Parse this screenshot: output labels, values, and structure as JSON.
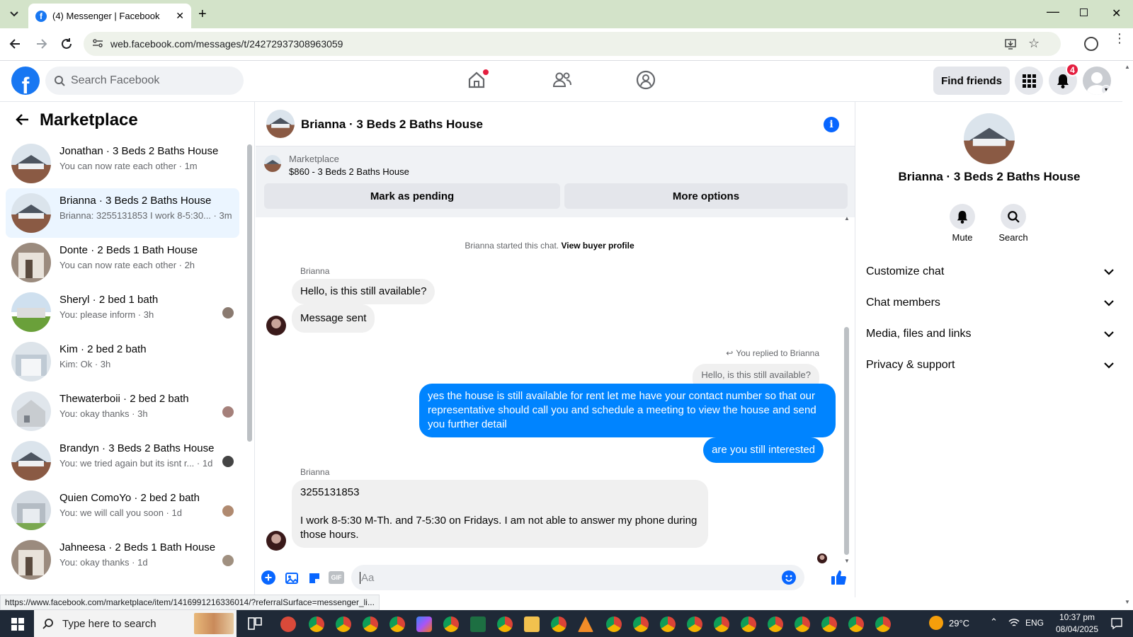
{
  "browser": {
    "tab_title": "(4) Messenger | Facebook",
    "url": "web.facebook.com/messages/t/24272937308963059"
  },
  "header": {
    "search_placeholder": "Search Facebook",
    "find_friends": "Find friends",
    "notification_count": "4"
  },
  "sidebar": {
    "title": "Marketplace",
    "conversations": [
      {
        "name": "Jonathan · 3 Beds 2 Baths House",
        "preview": "You can now rate each other · 1m"
      },
      {
        "name": "Brianna · 3 Beds 2 Baths House",
        "preview": "Brianna: 3255131853 I work 8-5:30... · 3m"
      },
      {
        "name": "Donte · 2 Beds 1 Bath House",
        "preview": "You can now rate each other · 2h"
      },
      {
        "name": "Sheryl · 2 bed 1 bath",
        "preview": "You: please inform · 3h"
      },
      {
        "name": "Kim · 2 bed 2 bath",
        "preview": "Kim: Ok · 3h"
      },
      {
        "name": "Thewaterboii · 2 bed 2 bath",
        "preview": "You: okay thanks · 3h"
      },
      {
        "name": "Brandyn · 3 Beds 2 Baths House",
        "preview": "You: we tried again but its isnt r... · 1d"
      },
      {
        "name": "Quien ComoYo · 2 bed 2 bath",
        "preview": "You: we will call you soon · 1d"
      },
      {
        "name": "Jahneesa · 2 Beds 1 Bath House",
        "preview": "You: okay thanks · 1d"
      }
    ]
  },
  "chat": {
    "title": "Brianna · 3 Beds 2 Baths House",
    "banner_label": "Marketplace",
    "banner_listing": "$860 - 3 Beds 2 Baths House",
    "mark_pending": "Mark as pending",
    "more_options": "More options",
    "started_text": "Brianna started this chat.",
    "view_profile": "View buyer profile",
    "sender_name": "Brianna",
    "msg1": "Hello, is this still available?",
    "msg2": "Message sent",
    "replied_label": "You replied to Brianna",
    "reply_quote": "Hello, is this still available?",
    "out1": "yes the house is still available for rent let me have your contact number so that our representative should call you and schedule a meeting to view the house and send you further detail",
    "out2": "are you still interested",
    "sender_name2": "Brianna",
    "in3_line1": "3255131853",
    "in3_line2": "I work 8-5:30 M-Th. and 7-5:30 on Fridays. I am not able to answer my phone during those hours.",
    "composer_placeholder": "Aa"
  },
  "details": {
    "title": "Brianna · 3 Beds 2 Baths House",
    "mute": "Mute",
    "search": "Search",
    "sections": [
      "Customize chat",
      "Chat members",
      "Media, files and links",
      "Privacy & support"
    ]
  },
  "status_url": "https://www.facebook.com/marketplace/item/1416991216336014/?referralSurface=messenger_li...",
  "taskbar": {
    "search_placeholder": "Type here to search",
    "weather": "29°C",
    "lang": "ENG",
    "time": "10:37 pm",
    "date": "08/04/2025"
  },
  "colors": {
    "fb_blue": "#1877f2",
    "bubble_out": "#0084ff",
    "notif_red": "#e41e3f"
  }
}
